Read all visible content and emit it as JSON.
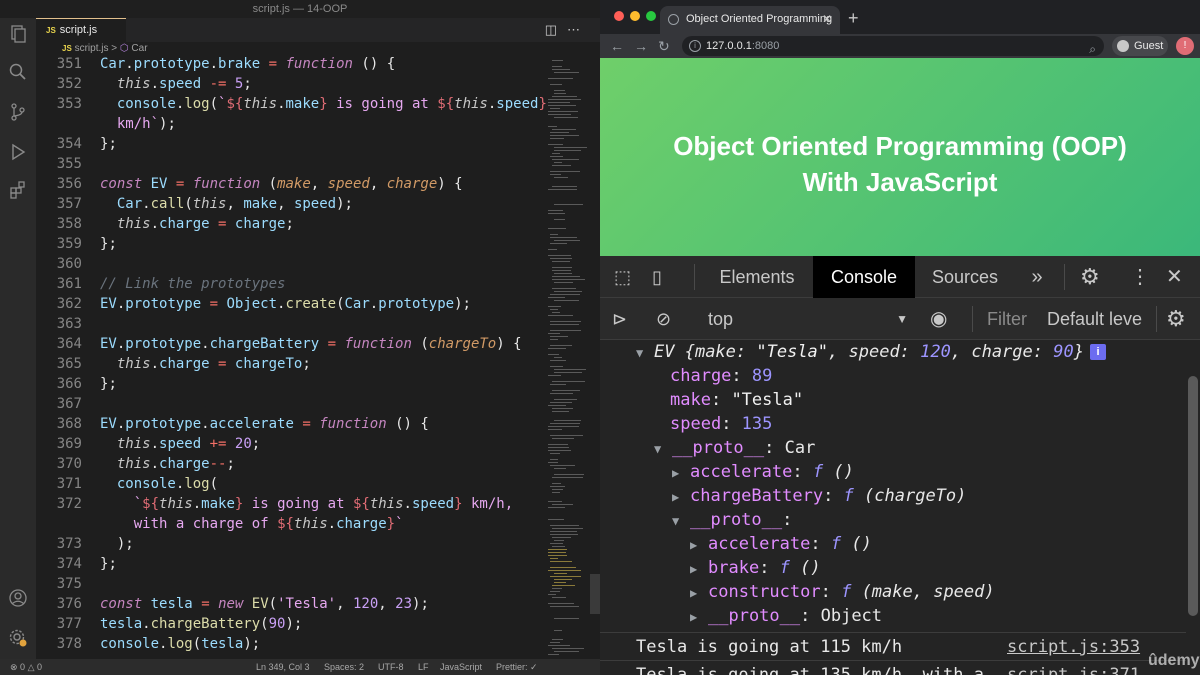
{
  "vscode": {
    "window_title": "script.js — 14-OOP",
    "tab": {
      "icon": "JS",
      "label": "script.js"
    },
    "breadcrumb": {
      "icon": "JS",
      "file": "script.js",
      "sep": ">",
      "symbol": "Car"
    },
    "status": {
      "errors": "0",
      "warnings": "0",
      "position": "Ln 349, Col 3",
      "spaces": "Spaces: 2",
      "encoding": "UTF-8",
      "eol": "LF",
      "language": "JavaScript",
      "prettier": "Prettier: ✓"
    }
  },
  "code_lines": [
    {
      "n": "351",
      "t": "Car.prototype.brake = function () {"
    },
    {
      "n": "352",
      "t": "  this.speed -= 5;"
    },
    {
      "n": "353",
      "t": "  console.log(`${this.make} is going at ${this.speed}"
    },
    {
      "n": "",
      "t": "  km/h`);"
    },
    {
      "n": "354",
      "t": "};"
    },
    {
      "n": "355",
      "t": ""
    },
    {
      "n": "356",
      "t": "const EV = function (make, speed, charge) {"
    },
    {
      "n": "357",
      "t": "  Car.call(this, make, speed);"
    },
    {
      "n": "358",
      "t": "  this.charge = charge;"
    },
    {
      "n": "359",
      "t": "};"
    },
    {
      "n": "360",
      "t": ""
    },
    {
      "n": "361",
      "t": "// Link the prototypes"
    },
    {
      "n": "362",
      "t": "EV.prototype = Object.create(Car.prototype);"
    },
    {
      "n": "363",
      "t": ""
    },
    {
      "n": "364",
      "t": "EV.prototype.chargeBattery = function (chargeTo) {"
    },
    {
      "n": "365",
      "t": "  this.charge = chargeTo;"
    },
    {
      "n": "366",
      "t": "};"
    },
    {
      "n": "367",
      "t": ""
    },
    {
      "n": "368",
      "t": "EV.prototype.accelerate = function () {"
    },
    {
      "n": "369",
      "t": "  this.speed += 20;"
    },
    {
      "n": "370",
      "t": "  this.charge--;"
    },
    {
      "n": "371",
      "t": "  console.log("
    },
    {
      "n": "372",
      "t": "    `${this.make} is going at ${this.speed} km/h,"
    },
    {
      "n": "",
      "t": "    with a charge of ${this.charge}`"
    },
    {
      "n": "373",
      "t": "  );"
    },
    {
      "n": "374",
      "t": "};"
    },
    {
      "n": "375",
      "t": ""
    },
    {
      "n": "376",
      "t": "const tesla = new EV('Tesla', 120, 23);"
    },
    {
      "n": "377",
      "t": "tesla.chargeBattery(90);"
    },
    {
      "n": "378",
      "t": "console.log(tesla);"
    }
  ],
  "browser": {
    "tab_title": "Object Oriented Programming",
    "new_tab": "+",
    "url_host": "127.0.0.1",
    "url_port": ":8080",
    "profile": "Guest",
    "page_heading_line1": "Object Oriented Programming (OOP)",
    "page_heading_line2": "With JavaScript"
  },
  "devtools": {
    "tabs": [
      "Elements",
      "Console",
      "Sources"
    ],
    "active_tab": "Console",
    "more": "»",
    "context": "top",
    "filter_placeholder": "Filter",
    "levels": "Default leve",
    "console": {
      "object_name": "EV",
      "object_preview_open": " {make: ",
      "make_str": "\"Tesla\"",
      "speed_key": ", speed: ",
      "speed_val": "120",
      "charge_key": ", charge: ",
      "charge_val": "90",
      "object_preview_close": "}",
      "info": "i",
      "props": [
        {
          "key": "charge",
          "value": "89",
          "kind": "num"
        },
        {
          "key": "make",
          "value": "\"Tesla\"",
          "kind": "str"
        },
        {
          "key": "speed",
          "value": "135",
          "kind": "num"
        }
      ],
      "proto1": {
        "key": "__proto__",
        "value": "Car"
      },
      "proto1_items": [
        {
          "key": "accelerate",
          "f": "f",
          "sig": " ()"
        },
        {
          "key": "chargeBattery",
          "f": "f",
          "sig": " (chargeTo)"
        }
      ],
      "proto2": {
        "key": "__proto__",
        "value": ""
      },
      "proto2_items": [
        {
          "key": "accelerate",
          "f": "f",
          "sig": " ()"
        },
        {
          "key": "brake",
          "f": "f",
          "sig": " ()"
        },
        {
          "key": "constructor",
          "f": "f",
          "sig": " (make, speed)"
        }
      ],
      "proto3": {
        "key": "__proto__",
        "value": "Object"
      },
      "logs": [
        {
          "text": "Tesla is going at 115 km/h",
          "src": "script.js:353"
        },
        {
          "text": "Tesla is going at 135 km/h, with a",
          "src": "script.js:371"
        }
      ]
    }
  },
  "watermark": "ûdemy"
}
